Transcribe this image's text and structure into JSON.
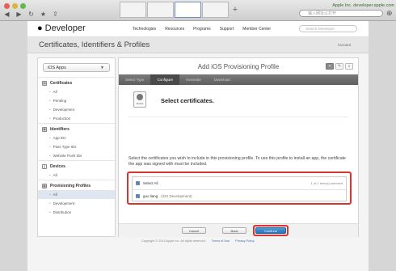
{
  "browser": {
    "url_host": "Apple Inc. developer.apple.com",
    "search_placeholder": "输入网址以打开"
  },
  "header": {
    "brand": "Developer",
    "nav": [
      "Technologies",
      "Resources",
      "Programs",
      "Support",
      "Member Center"
    ],
    "search_placeholder": "Search Developer"
  },
  "subheader": {
    "title": "Certificates, Identifiers & Profiles",
    "account": "Account"
  },
  "sidebar": {
    "selector": "iOS Apps",
    "sections": [
      {
        "title": "Certificates",
        "items": [
          "All",
          "Pending",
          "Development",
          "Production"
        ]
      },
      {
        "title": "Identifiers",
        "items": [
          "App IDs",
          "Pass Type IDs",
          "Website Push IDs"
        ]
      },
      {
        "title": "Devices",
        "items": [
          "All"
        ]
      },
      {
        "title": "Provisioning Profiles",
        "items": [
          "All",
          "Development",
          "Distribution"
        ]
      }
    ]
  },
  "main": {
    "title": "Add iOS Provisioning Profile",
    "steps": [
      "Select Type",
      "Configure",
      "Generate",
      "Download"
    ],
    "current_step": "Configure",
    "heading": "Select certificates.",
    "icon_caption": "Mobile",
    "instructions": "Select the certificates you wish to include in this provisioning profile. To use this profile to install an app, the certificate the app was signed with must be included.",
    "select_all": "Select All",
    "selection_count": "1 of 1 item(s) selected",
    "certificates": [
      {
        "name": "guo liang",
        "type": "(iOS Development)"
      }
    ],
    "buttons": {
      "cancel": "Cancel",
      "back": "Back",
      "continue": "Continue"
    }
  },
  "footer": {
    "copyright": "Copyright © 2013 Apple Inc. All rights reserved.",
    "links": [
      "Terms of Use",
      "Privacy Policy"
    ]
  },
  "colors": {
    "accent": "#2a72b8",
    "highlight": "#d9352d"
  }
}
